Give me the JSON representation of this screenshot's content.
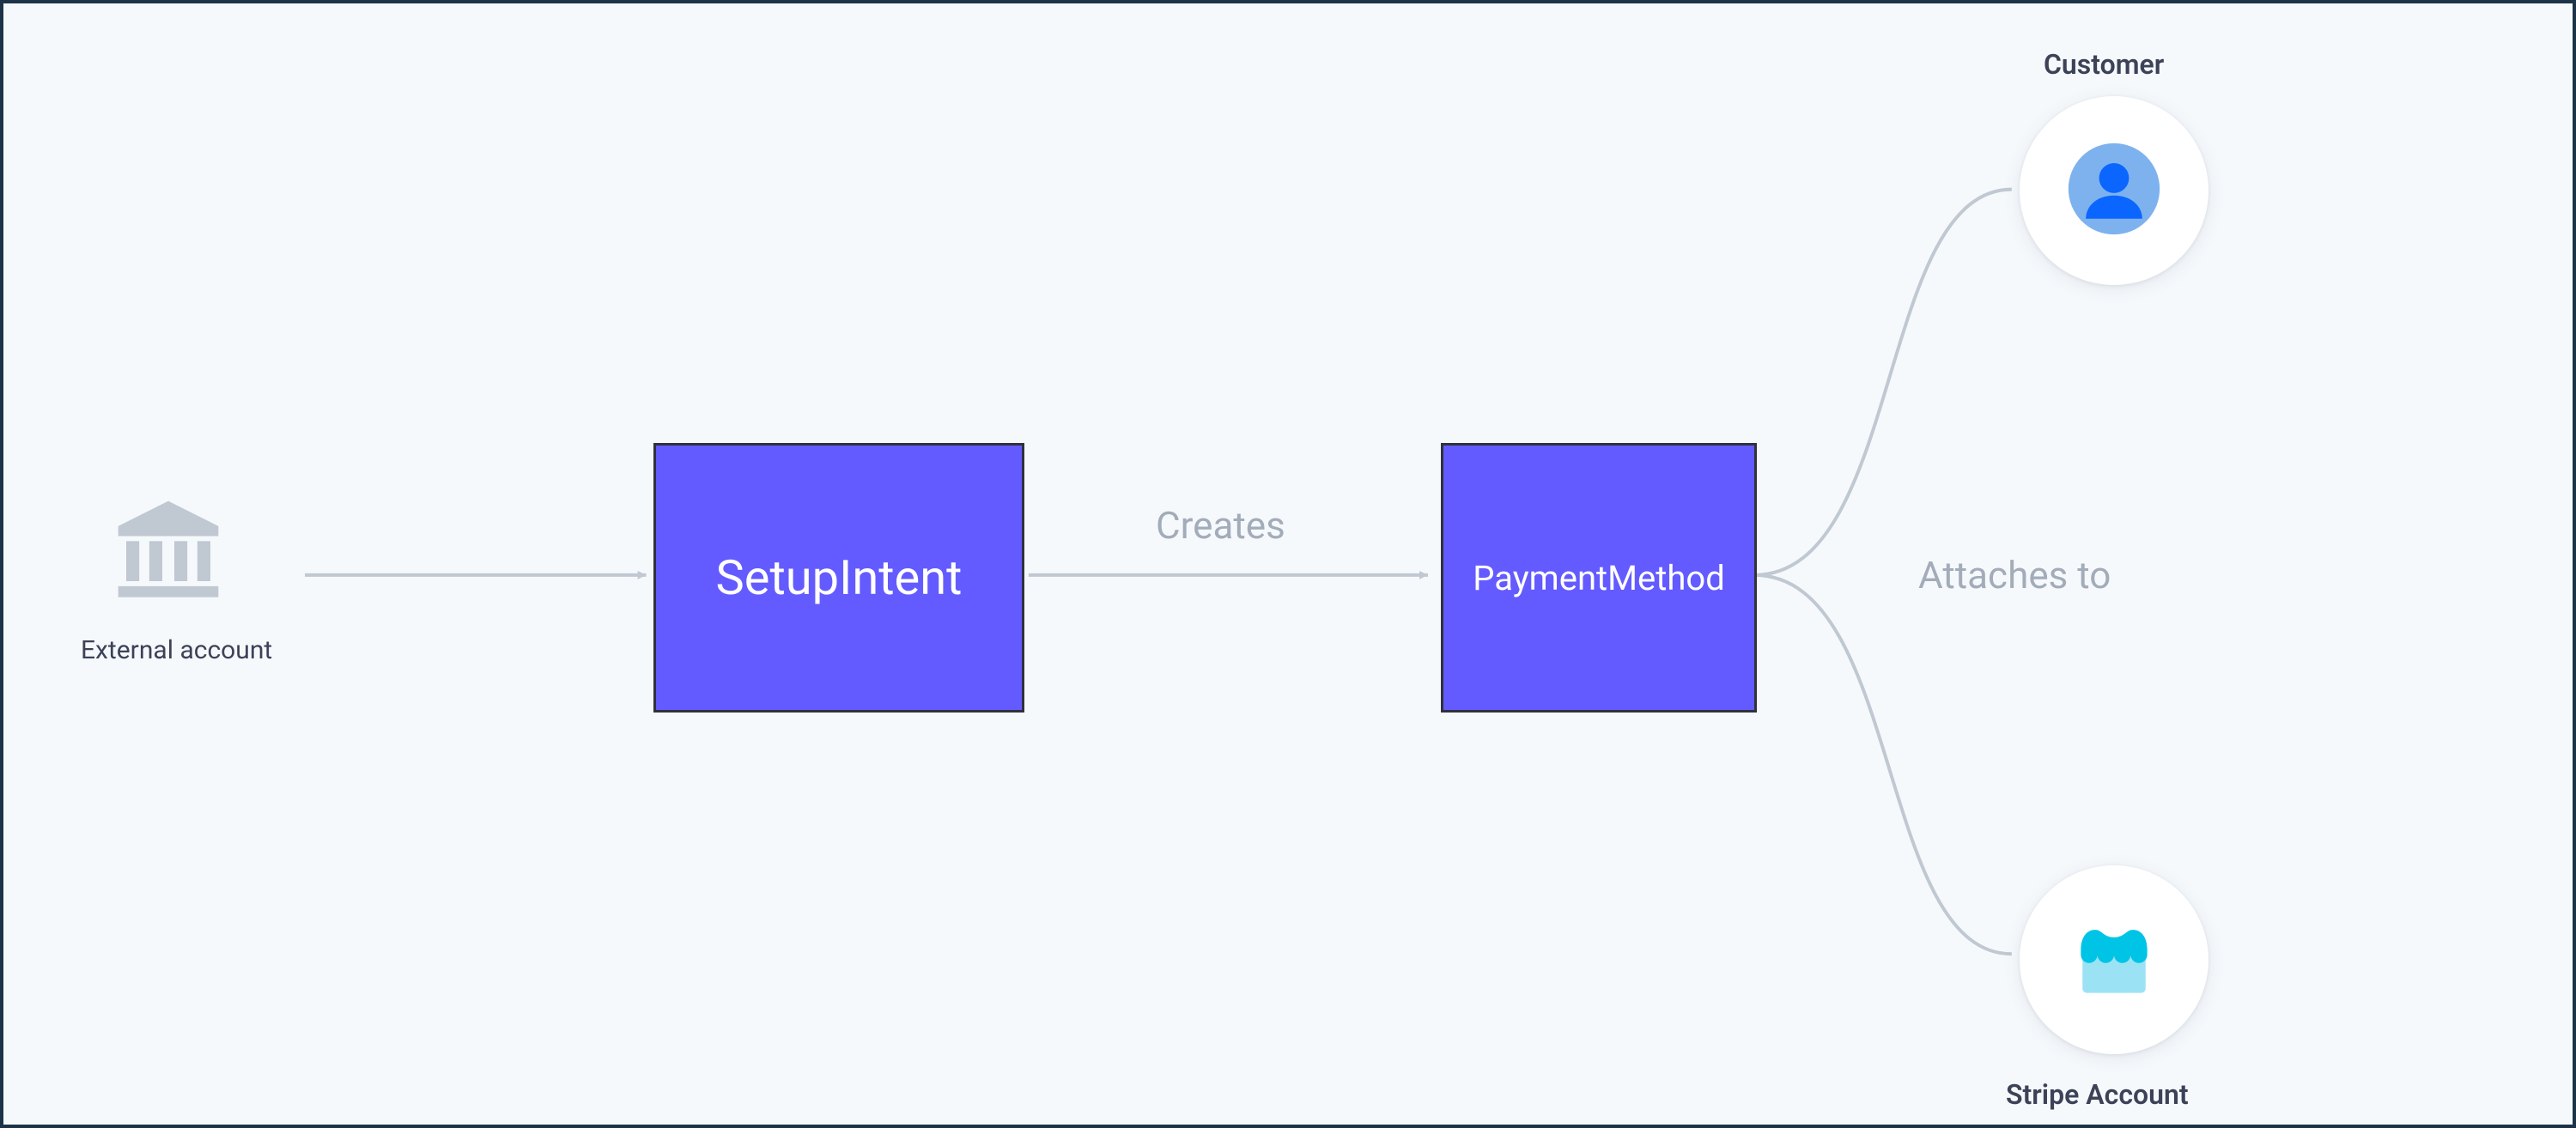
{
  "nodes": {
    "external_account": {
      "label": "External account",
      "icon": "bank-icon"
    },
    "setup_intent": {
      "label": "SetupIntent"
    },
    "payment_method": {
      "label": "PaymentMethod"
    },
    "customer": {
      "label": "Customer",
      "icon": "person-icon"
    },
    "stripe_account": {
      "label": "Stripe Account",
      "icon": "storefront-icon"
    }
  },
  "edges": {
    "creates": {
      "label": "Creates"
    },
    "attaches": {
      "label": "Attaches to"
    }
  },
  "colors": {
    "box_fill": "#635bff",
    "box_border": "#30313d",
    "frame_border": "#1d3448",
    "background": "#f6f9fc",
    "connector": "#c0c8d2",
    "label_muted": "#a3acb9",
    "text_primary": "#3c4257"
  }
}
